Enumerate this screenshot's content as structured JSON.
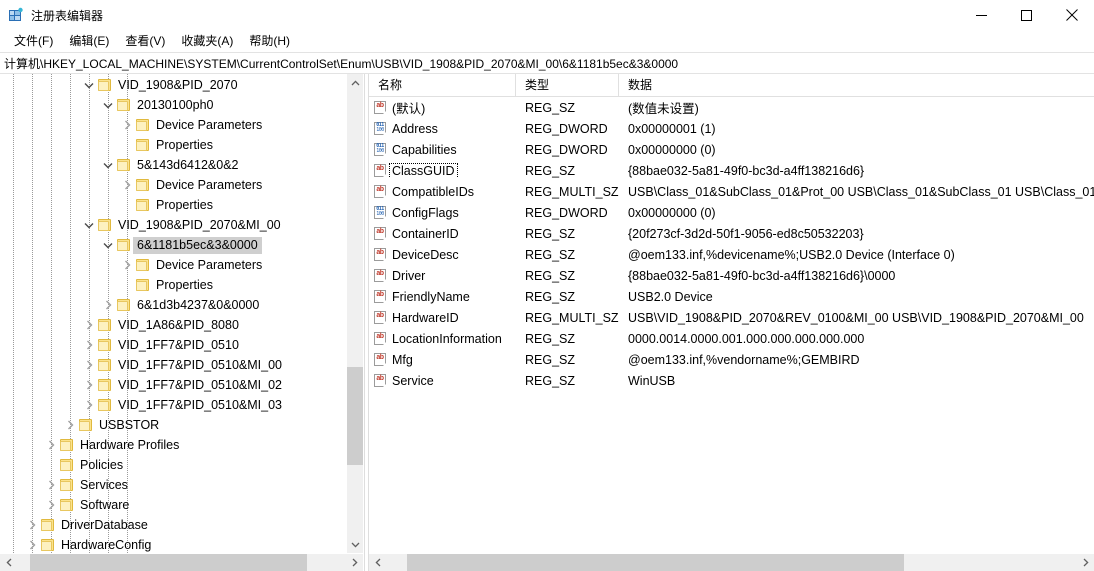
{
  "window": {
    "title": "注册表编辑器",
    "icon": "registry-editor-icon",
    "controls": {
      "minimize": "minimize-icon",
      "maximize": "maximize-icon",
      "close": "close-icon"
    }
  },
  "menubar": {
    "items": [
      {
        "label": "文件(F)"
      },
      {
        "label": "编辑(E)"
      },
      {
        "label": "查看(V)"
      },
      {
        "label": "收藏夹(A)"
      },
      {
        "label": "帮助(H)"
      }
    ]
  },
  "address": {
    "path": "计算机\\HKEY_LOCAL_MACHINE\\SYSTEM\\CurrentControlSet\\Enum\\USB\\VID_1908&PID_2070&MI_00\\6&1181b5ec&3&0000"
  },
  "tree": {
    "items": [
      {
        "label": "VID_1908&PID_2070",
        "indent": 5,
        "expander": "expanded",
        "selected": false
      },
      {
        "label": "20130100ph0",
        "indent": 6,
        "expander": "expanded",
        "selected": false
      },
      {
        "label": "Device Parameters",
        "indent": 7,
        "expander": "collapsed",
        "selected": false
      },
      {
        "label": "Properties",
        "indent": 7,
        "expander": "leaf",
        "selected": false
      },
      {
        "label": "5&143d6412&0&2",
        "indent": 6,
        "expander": "expanded",
        "selected": false
      },
      {
        "label": "Device Parameters",
        "indent": 7,
        "expander": "collapsed",
        "selected": false
      },
      {
        "label": "Properties",
        "indent": 7,
        "expander": "leaf",
        "selected": false
      },
      {
        "label": "VID_1908&PID_2070&MI_00",
        "indent": 5,
        "expander": "expanded",
        "selected": false
      },
      {
        "label": "6&1181b5ec&3&0000",
        "indent": 6,
        "expander": "expanded",
        "selected": true
      },
      {
        "label": "Device Parameters",
        "indent": 7,
        "expander": "collapsed",
        "selected": false
      },
      {
        "label": "Properties",
        "indent": 7,
        "expander": "leaf",
        "selected": false
      },
      {
        "label": "6&1d3b4237&0&0000",
        "indent": 6,
        "expander": "collapsed",
        "selected": false
      },
      {
        "label": "VID_1A86&PID_8080",
        "indent": 5,
        "expander": "collapsed",
        "selected": false
      },
      {
        "label": "VID_1FF7&PID_0510",
        "indent": 5,
        "expander": "collapsed",
        "selected": false
      },
      {
        "label": "VID_1FF7&PID_0510&MI_00",
        "indent": 5,
        "expander": "collapsed",
        "selected": false
      },
      {
        "label": "VID_1FF7&PID_0510&MI_02",
        "indent": 5,
        "expander": "collapsed",
        "selected": false
      },
      {
        "label": "VID_1FF7&PID_0510&MI_03",
        "indent": 5,
        "expander": "collapsed",
        "selected": false
      },
      {
        "label": "USBSTOR",
        "indent": 4,
        "expander": "collapsed",
        "selected": false
      },
      {
        "label": "Hardware Profiles",
        "indent": 3,
        "expander": "collapsed",
        "selected": false
      },
      {
        "label": "Policies",
        "indent": 3,
        "expander": "leaf",
        "selected": false
      },
      {
        "label": "Services",
        "indent": 3,
        "expander": "collapsed",
        "selected": false
      },
      {
        "label": "Software",
        "indent": 3,
        "expander": "collapsed",
        "selected": false
      },
      {
        "label": "DriverDatabase",
        "indent": 2,
        "expander": "collapsed",
        "selected": false
      },
      {
        "label": "HardwareConfig",
        "indent": 2,
        "expander": "collapsed",
        "selected": false
      }
    ]
  },
  "list": {
    "columns": [
      {
        "label": "名称"
      },
      {
        "label": "类型"
      },
      {
        "label": "数据"
      }
    ],
    "rows": [
      {
        "name": "(默认)",
        "type": "REG_SZ",
        "data": "(数值未设置)",
        "icon": "string-value-icon",
        "focused": false
      },
      {
        "name": "Address",
        "type": "REG_DWORD",
        "data": "0x00000001 (1)",
        "icon": "dword-value-icon",
        "focused": false
      },
      {
        "name": "Capabilities",
        "type": "REG_DWORD",
        "data": "0x00000000 (0)",
        "icon": "dword-value-icon",
        "focused": false
      },
      {
        "name": "ClassGUID",
        "type": "REG_SZ",
        "data": "{88bae032-5a81-49f0-bc3d-a4ff138216d6}",
        "icon": "string-value-icon",
        "focused": true
      },
      {
        "name": "CompatibleIDs",
        "type": "REG_MULTI_SZ",
        "data": "USB\\Class_01&SubClass_01&Prot_00 USB\\Class_01&SubClass_01 USB\\Class_01",
        "icon": "string-value-icon",
        "focused": false
      },
      {
        "name": "ConfigFlags",
        "type": "REG_DWORD",
        "data": "0x00000000 (0)",
        "icon": "dword-value-icon",
        "focused": false
      },
      {
        "name": "ContainerID",
        "type": "REG_SZ",
        "data": "{20f273cf-3d2d-50f1-9056-ed8c50532203}",
        "icon": "string-value-icon",
        "focused": false
      },
      {
        "name": "DeviceDesc",
        "type": "REG_SZ",
        "data": "@oem133.inf,%devicename%;USB2.0 Device (Interface 0)",
        "icon": "string-value-icon",
        "focused": false
      },
      {
        "name": "Driver",
        "type": "REG_SZ",
        "data": "{88bae032-5a81-49f0-bc3d-a4ff138216d6}\\0000",
        "icon": "string-value-icon",
        "focused": false
      },
      {
        "name": "FriendlyName",
        "type": "REG_SZ",
        "data": "USB2.0 Device",
        "icon": "string-value-icon",
        "focused": false
      },
      {
        "name": "HardwareID",
        "type": "REG_MULTI_SZ",
        "data": "USB\\VID_1908&PID_2070&REV_0100&MI_00 USB\\VID_1908&PID_2070&MI_00",
        "icon": "string-value-icon",
        "focused": false
      },
      {
        "name": "LocationInformation",
        "type": "REG_SZ",
        "data": "0000.0014.0000.001.000.000.000.000.000",
        "icon": "string-value-icon",
        "focused": false
      },
      {
        "name": "Mfg",
        "type": "REG_SZ",
        "data": "@oem133.inf,%vendorname%;GEMBIRD",
        "icon": "string-value-icon",
        "focused": false
      },
      {
        "name": "Service",
        "type": "REG_SZ",
        "data": "WinUSB",
        "icon": "string-value-icon",
        "focused": false
      }
    ]
  },
  "scrollbars": {
    "tree_vertical": {
      "thumb_top_pct": 62,
      "thumb_height_pct": 22
    },
    "tree_horizontal": {
      "thumb_left_pct": 4,
      "thumb_width_pct": 84
    },
    "list_horizontal": {
      "thumb_left_pct": 3,
      "thumb_width_pct": 72
    }
  },
  "colors": {
    "selection": "#cfcfcf",
    "folder": "#fbe38d",
    "string_icon": "#c0392b",
    "dword_icon": "#1f5fb0",
    "scroll_thumb": "#cdcdcd"
  }
}
